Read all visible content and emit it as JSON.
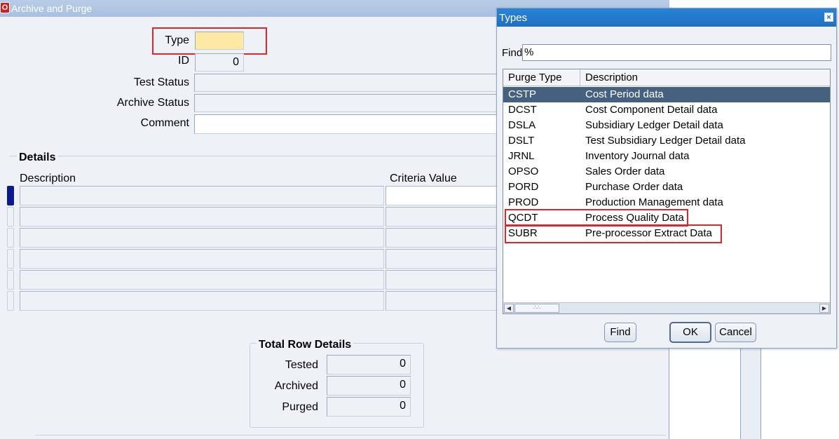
{
  "main_window": {
    "title": "Archive and Purge",
    "fields": {
      "type_label": "Type",
      "type_value": "",
      "id_label": "ID",
      "id_value": "0",
      "test_status_label": "Test Status",
      "archive_status_label": "Archive Status",
      "comment_label": "Comment"
    },
    "details": {
      "section_label": "Details",
      "columns": [
        "Description",
        "Criteria Value"
      ]
    },
    "totals": {
      "section_label": "Total Row Details",
      "rows": [
        {
          "label": "Tested",
          "value": "0"
        },
        {
          "label": "Archived",
          "value": "0"
        },
        {
          "label": "Purged",
          "value": "0"
        }
      ]
    }
  },
  "dialog": {
    "title": "Types",
    "find_label": "Find",
    "find_value": "%",
    "columns": [
      "Purge Type",
      "Description"
    ],
    "rows": [
      {
        "code": "CSTP",
        "desc": "Cost Period data",
        "selected": true
      },
      {
        "code": "DCST",
        "desc": "Cost Component Detail data"
      },
      {
        "code": "DSLA",
        "desc": "Subsidiary Ledger Detail data"
      },
      {
        "code": "DSLT",
        "desc": "Test Subsidiary Ledger Detail data"
      },
      {
        "code": "JRNL",
        "desc": "Inventory Journal data"
      },
      {
        "code": "OPSO",
        "desc": "Sales Order data"
      },
      {
        "code": "PORD",
        "desc": "Purchase Order data"
      },
      {
        "code": "PROD",
        "desc": "Production Management data"
      },
      {
        "code": "QCDT",
        "desc": "Process Quality Data",
        "highlighted": true
      },
      {
        "code": "SUBR",
        "desc": "Pre-processor Extract Data",
        "highlighted": true
      }
    ],
    "buttons": {
      "find": "Find",
      "ok": "OK",
      "cancel": "Cancel"
    }
  },
  "colors": {
    "accent": "#1d6fc4",
    "selection": "#46607f",
    "highlight_box": "#e0262b",
    "required_field": "#fde9a4"
  }
}
